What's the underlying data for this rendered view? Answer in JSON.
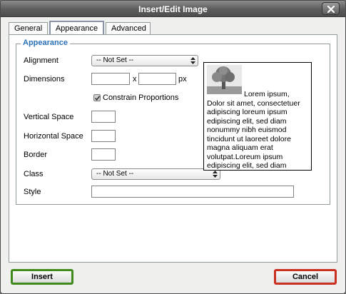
{
  "window": {
    "title": "Insert/Edit Image"
  },
  "tabs": [
    {
      "label": "General",
      "active": false
    },
    {
      "label": "Appearance",
      "active": true
    },
    {
      "label": "Advanced",
      "active": false
    }
  ],
  "appearance": {
    "legend": "Appearance",
    "alignment": {
      "label": "Alignment",
      "value": "-- Not Set --"
    },
    "dimensions": {
      "label": "Dimensions",
      "width": "",
      "height": "",
      "separator": "x",
      "unit": "px"
    },
    "constrain": {
      "label": "Constrain Proportions",
      "checked": true
    },
    "vspace": {
      "label": "Vertical Space",
      "value": ""
    },
    "hspace": {
      "label": "Horizontal Space",
      "value": ""
    },
    "border": {
      "label": "Border",
      "value": ""
    },
    "class": {
      "label": "Class",
      "value": "-- Not Set --"
    },
    "style": {
      "label": "Style",
      "value": ""
    },
    "preview_text": "Lorem ipsum, Dolor sit amet, consectetuer adipiscing loreum ipsum edipiscing elit, sed diam nonummy nibh euismod tincidunt ut laoreet dolore magna aliquam erat volutpat.Loreum ipsum edipiscing elit, sed diam"
  },
  "buttons": {
    "insert": "Insert",
    "cancel": "Cancel"
  },
  "colors": {
    "legend": "#2b6fb6",
    "insert_border": "#3f8a1a",
    "cancel_border": "#c9301f"
  }
}
